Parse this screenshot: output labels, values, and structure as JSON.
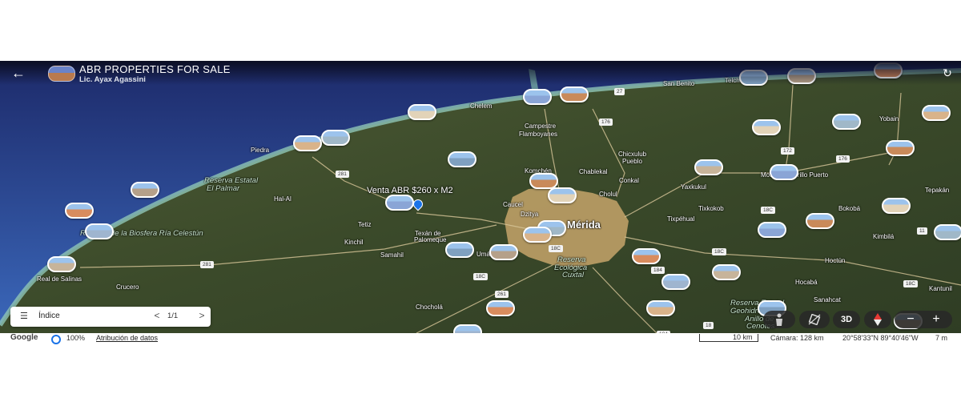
{
  "header": {
    "title": "ABR PROPERTIES FOR SALE",
    "subtitle": "Lic. Ayax Agassini",
    "back_icon": "←",
    "refresh_icon": "↻"
  },
  "map": {
    "labels": [
      {
        "text": "Mérida",
        "kind": "city"
      },
      {
        "text": "San Benito",
        "kind": "place"
      },
      {
        "text": "Telch",
        "kind": "place"
      },
      {
        "text": "Chelem",
        "kind": "place"
      },
      {
        "text": "Campestre",
        "kind": "place"
      },
      {
        "text": "Flamboyanes",
        "kind": "place"
      },
      {
        "text": "Yobain",
        "kind": "place"
      },
      {
        "text": "Piedra",
        "kind": "place"
      },
      {
        "text": "Chicxulub",
        "kind": "place"
      },
      {
        "text": "Pueblo",
        "kind": "place"
      },
      {
        "text": "Komchén",
        "kind": "place"
      },
      {
        "text": "Chablekal",
        "kind": "place"
      },
      {
        "text": "Reserva Estatal",
        "kind": "park"
      },
      {
        "text": "El Palmar",
        "kind": "park"
      },
      {
        "text": "Conkal",
        "kind": "place"
      },
      {
        "text": "Yaxkukul",
        "kind": "place"
      },
      {
        "text": "Motul de Carrillo Puerto",
        "kind": "place"
      },
      {
        "text": "Tepakán",
        "kind": "place"
      },
      {
        "text": "Hal-Al",
        "kind": "place"
      },
      {
        "text": "Dzitya",
        "kind": "place"
      },
      {
        "text": "Cholul",
        "kind": "place"
      },
      {
        "text": "Caucel",
        "kind": "place"
      },
      {
        "text": "Tixkokob",
        "kind": "place"
      },
      {
        "text": "Bokobá",
        "kind": "place"
      },
      {
        "text": "Tixpéhual",
        "kind": "place"
      },
      {
        "text": "Reserva de la Biosfera Ría Celestún",
        "kind": "park"
      },
      {
        "text": "Tetiz",
        "kind": "place"
      },
      {
        "text": "Kinchil",
        "kind": "place"
      },
      {
        "text": "Texán de",
        "kind": "place"
      },
      {
        "text": "Palomeque",
        "kind": "place"
      },
      {
        "text": "Kimbilá",
        "kind": "place"
      },
      {
        "text": "Samahil",
        "kind": "place"
      },
      {
        "text": "Umán",
        "kind": "place"
      },
      {
        "text": "Reserva",
        "kind": "park"
      },
      {
        "text": "Ecológica",
        "kind": "park"
      },
      {
        "text": "Cuxtal",
        "kind": "park"
      },
      {
        "text": "Hoctún",
        "kind": "place"
      },
      {
        "text": "Real de Salinas",
        "kind": "place"
      },
      {
        "text": "Hocabá",
        "kind": "place"
      },
      {
        "text": "Kantunil",
        "kind": "place"
      },
      {
        "text": "Crucero",
        "kind": "place"
      },
      {
        "text": "Sanahcat",
        "kind": "place"
      },
      {
        "text": "Chocholá",
        "kind": "place"
      },
      {
        "text": "Reserva Estatal",
        "kind": "park"
      },
      {
        "text": "Geohidrológica",
        "kind": "park"
      },
      {
        "text": "Anillo de",
        "kind": "park"
      },
      {
        "text": "Cenotes",
        "kind": "park"
      }
    ],
    "route_shields": [
      "27",
      "176",
      "172",
      "176",
      "281",
      "18C",
      "18C",
      "281",
      "18C",
      "184",
      "261",
      "18C",
      "11",
      "18C",
      "18",
      "184"
    ],
    "featured_pin": "Venta ABR $260 x M2",
    "pin_count": 38
  },
  "index_panel": {
    "menu_icon": "☰",
    "label": "Índice",
    "prev": "<",
    "page": "1/1",
    "next": ">"
  },
  "controls": {
    "pegman_icon": "person-icon",
    "tilt_icon": "rotate-icon",
    "mode_3d": "3D",
    "compass_icon": "compass-icon",
    "zoom_out": "−",
    "zoom_in": "+"
  },
  "footer": {
    "brand": "Google",
    "zoom": "100%",
    "attribution": "Atribución de datos",
    "scale": "10 km",
    "camera": "Cámara: 128 km",
    "coords": "20°58'33\"N 89°40'46\"W",
    "elevation": "7 m"
  },
  "colors": {
    "sea": "#2f4da0",
    "coast": "#7fb7a8",
    "land": "#3c4a2c",
    "city": "#c7a770",
    "pin_border": "#ffffff",
    "pin_blue": "#1a73e8"
  }
}
